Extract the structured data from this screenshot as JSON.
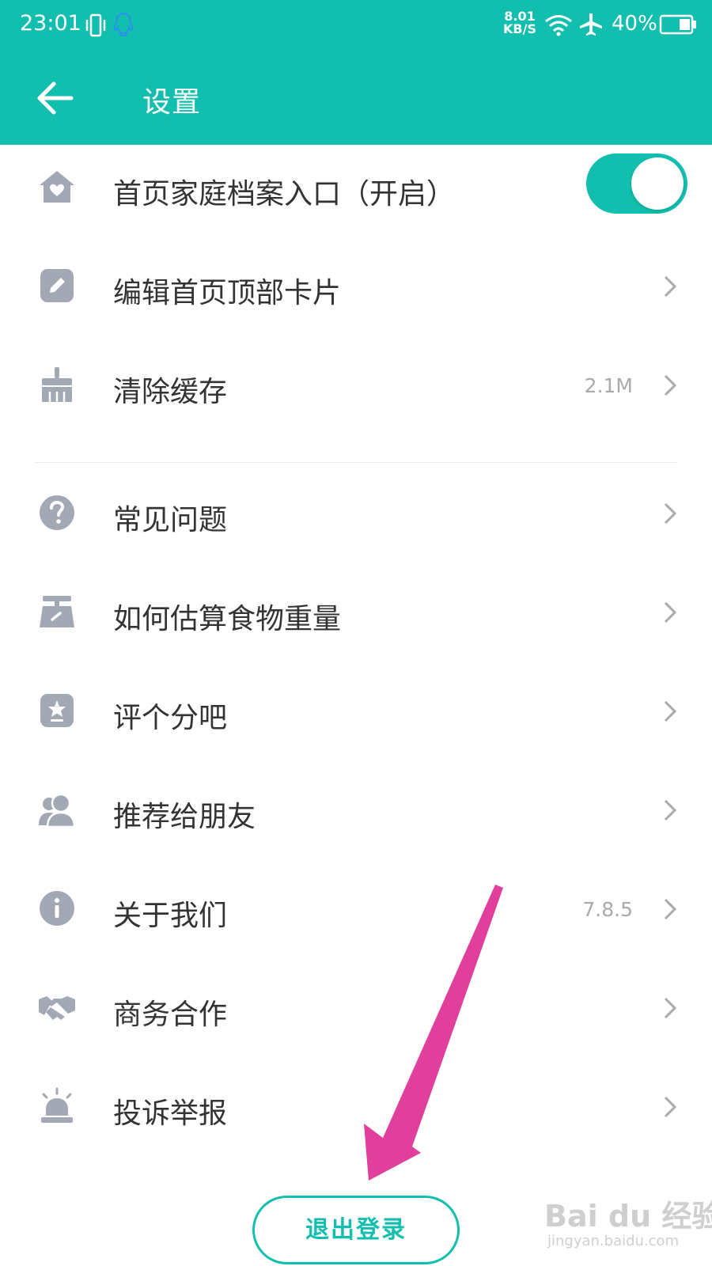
{
  "status_bar": {
    "time": "23:01",
    "net_speed_value": "8.01",
    "net_speed_unit": "KB/S",
    "battery": "40%"
  },
  "nav": {
    "title": "设置"
  },
  "settings": [
    {
      "label": "首页家庭档案入口（开启）",
      "icon": "home-heart-icon",
      "toggle_on": true
    },
    {
      "label": "编辑首页顶部卡片",
      "icon": "edit-icon"
    },
    {
      "label": "清除缓存",
      "icon": "broom-icon",
      "value": "2.1M"
    },
    {
      "label": "常见问题",
      "icon": "question-icon"
    },
    {
      "label": "如何估算食物重量",
      "icon": "scale-icon"
    },
    {
      "label": "评个分吧",
      "icon": "star-icon"
    },
    {
      "label": "推荐给朋友",
      "icon": "friends-icon"
    },
    {
      "label": "关于我们",
      "icon": "info-icon",
      "value": "7.8.5"
    },
    {
      "label": "商务合作",
      "icon": "handshake-icon"
    },
    {
      "label": "投诉举报",
      "icon": "alarm-icon"
    }
  ],
  "logout_label": "退出登录",
  "watermark": {
    "main": "Bai du 经验",
    "sub": "jingyan.baidu.com"
  },
  "colors": {
    "brand": "#12bfae",
    "icon_gray": "#a3a8b5",
    "annotation_arrow": "#e0409b"
  }
}
